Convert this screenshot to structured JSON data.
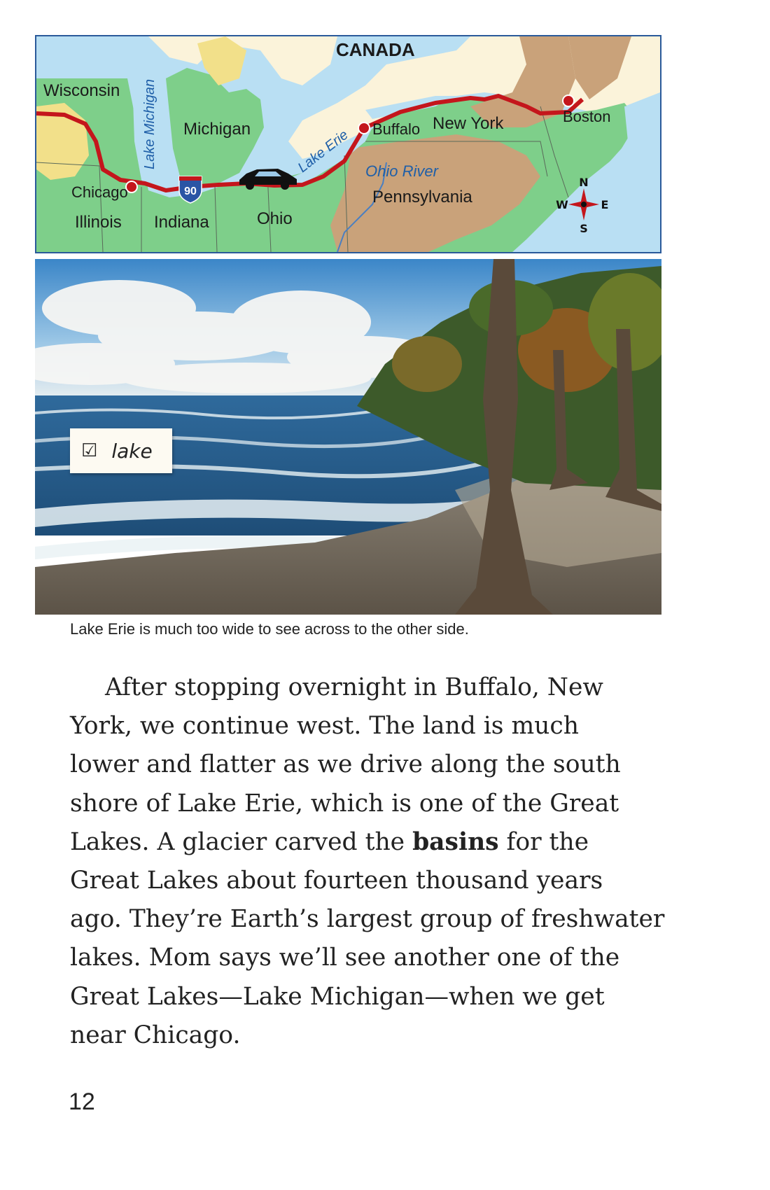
{
  "map": {
    "labels": {
      "canada": "CANADA",
      "wisconsin": "Wisconsin",
      "lake_michigan": "Lake Michigan",
      "michigan": "Michigan",
      "chicago": "Chicago",
      "illinois": "Illinois",
      "indiana": "Indiana",
      "ohio": "Ohio",
      "lake_erie": "Lake Erie",
      "buffalo": "Buffalo",
      "new_york": "New York",
      "boston": "Boston",
      "ohio_river": "Ohio River",
      "pennsylvania": "Pennsylvania",
      "highway_shield": "90"
    },
    "compass": {
      "n": "N",
      "s": "S",
      "e": "E",
      "w": "W"
    },
    "colors": {
      "water": "#b9dff3",
      "lowland": "#7ecf8a",
      "upland": "#f2e08a",
      "mountains": "#c9a27a",
      "route": "#c4161c"
    }
  },
  "photo": {
    "vocab_card": {
      "check_icon": "☑",
      "word": "lake"
    },
    "caption": "Lake Erie is much too wide to see across to the other side."
  },
  "body": {
    "lines": [
      "After stopping overnight in Buffalo, New",
      "York, we continue west. The land is much",
      "lower and flatter as we drive along the south",
      "shore of Lake Erie, which is one of the Great"
    ],
    "line5_before": "Lakes. A glacier carved the ",
    "line5_bold": "basins",
    "line5_after": " for the",
    "lines_rest": [
      "Great Lakes about fourteen thousand years",
      "ago. They’re Earth’s largest group of freshwater",
      "lakes. Mom says we’ll see another one of the",
      "Great Lakes—Lake Michigan—when we get",
      "near Chicago."
    ]
  },
  "page_number": "12"
}
